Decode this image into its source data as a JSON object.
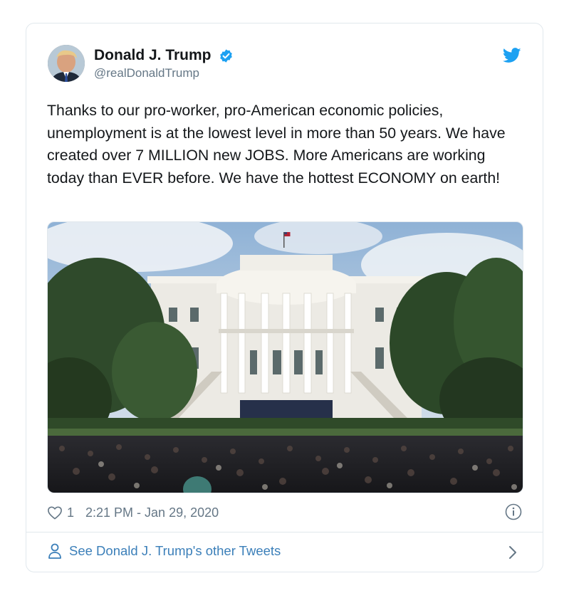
{
  "tweet": {
    "display_name": "Donald J. Trump",
    "handle": "@realDonaldTrump",
    "text": "Thanks to our pro-worker, pro-American economic policies, unemployment is at the lowest level in more than 50 years. We have created over 7 MILLION new JOBS. More Americans are working today than EVER before. We have the hottest ECONOMY on earth!",
    "like_count": "1",
    "timestamp": "2:21 PM - Jan 29, 2020",
    "footer_label": "See Donald J. Trump's other Tweets"
  },
  "icons": {
    "verified": "verified-badge-icon",
    "brand": "twitter-bird-icon",
    "like": "heart-icon",
    "info": "info-icon",
    "profile": "person-icon",
    "more": "chevron-right-icon"
  },
  "colors": {
    "accent": "#1da1f2",
    "link": "#3b7fb9",
    "muted": "#657786",
    "text": "#14171a",
    "border": "#e1e8ed"
  }
}
